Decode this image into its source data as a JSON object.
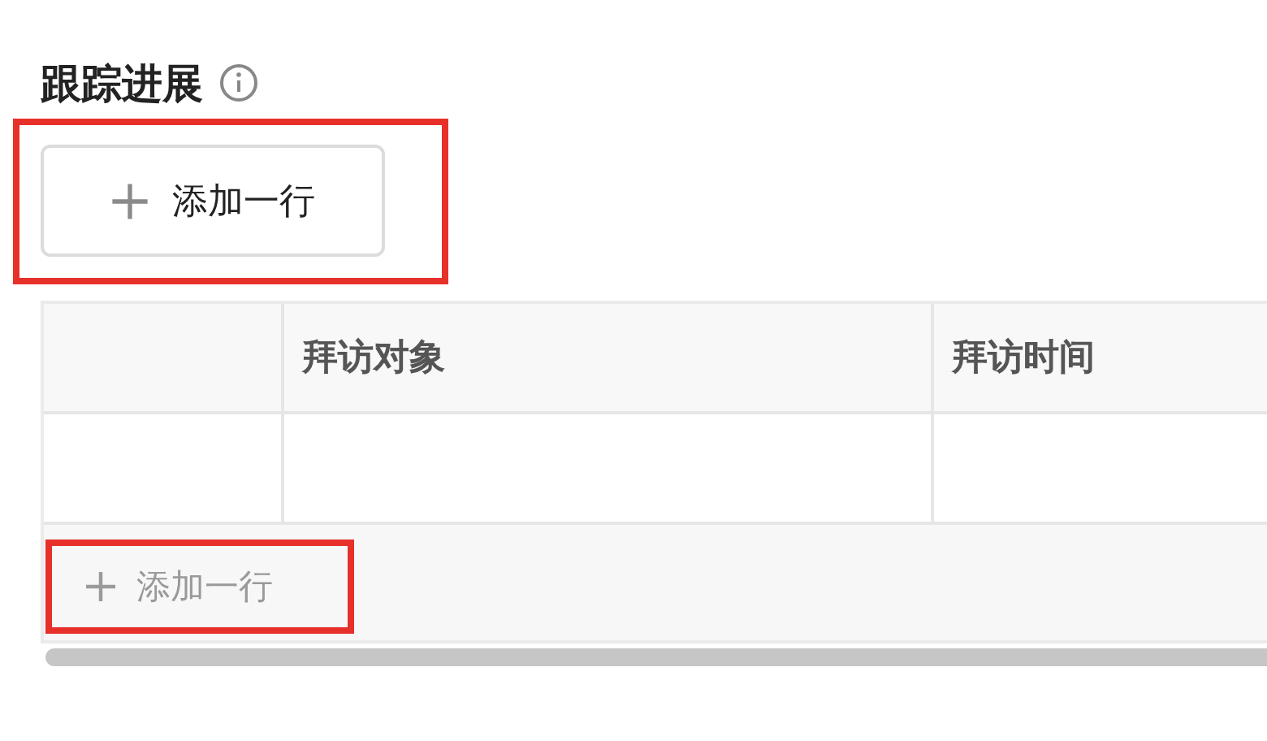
{
  "section": {
    "title": "跟踪进展"
  },
  "add_row_button": {
    "label": "添加一行",
    "highlighted": true
  },
  "table": {
    "columns": [
      "拜访对象",
      "拜访时间"
    ],
    "footer_add": {
      "label": "添加一行",
      "highlighted": true
    }
  }
}
